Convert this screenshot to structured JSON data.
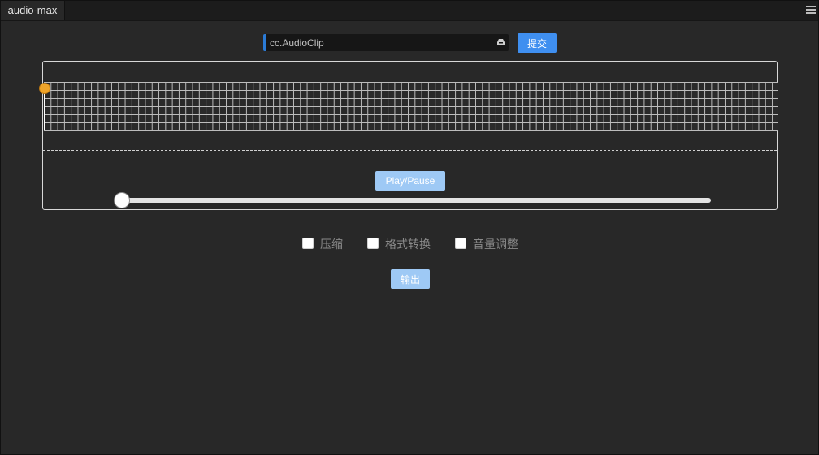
{
  "tab": {
    "title": "audio-max"
  },
  "asset": {
    "placeholder": "cc.AudioClip",
    "submit_label": "提交"
  },
  "player": {
    "play_label": "Play/Pause",
    "progress": 0
  },
  "options": [
    {
      "label": "压缩",
      "checked": false
    },
    {
      "label": "格式转换",
      "checked": false
    },
    {
      "label": "音量调整",
      "checked": false
    }
  ],
  "export_label": "输出",
  "colors": {
    "accent": "#3f8ff0",
    "button_light": "#9ec9f5",
    "playhead": "#f0a52a",
    "field_border": "#2b7bd6"
  }
}
